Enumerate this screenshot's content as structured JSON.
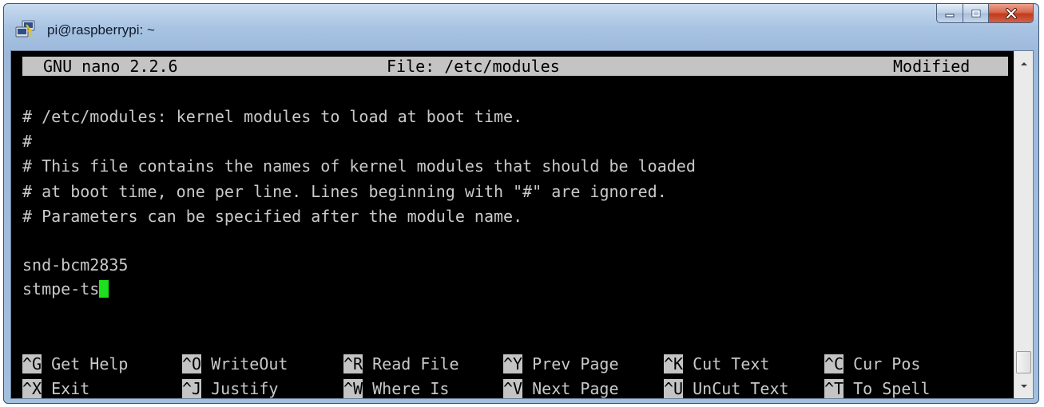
{
  "window": {
    "title": "pi@raspberrypi: ~",
    "icon": "putty-icon",
    "buttons": [
      "minimize-icon",
      "maximize-icon",
      "close-icon"
    ]
  },
  "nano": {
    "version": "GNU nano 2.2.6",
    "file": "File: /etc/modules",
    "status": "Modified",
    "lines": [
      "# /etc/modules: kernel modules to load at boot time.",
      "#",
      "# This file contains the names of kernel modules that should be loaded",
      "# at boot time, one per line. Lines beginning with \"#\" are ignored.",
      "# Parameters can be specified after the module name.",
      "",
      "snd-bcm2835",
      "stmpe-ts"
    ],
    "shortcuts_row1": [
      {
        "key": "^G",
        "label": " Get Help"
      },
      {
        "key": "^O",
        "label": " WriteOut"
      },
      {
        "key": "^R",
        "label": " Read File"
      },
      {
        "key": "^Y",
        "label": " Prev Page"
      },
      {
        "key": "^K",
        "label": " Cut Text"
      },
      {
        "key": "^C",
        "label": " Cur Pos"
      }
    ],
    "shortcuts_row2": [
      {
        "key": "^X",
        "label": " Exit"
      },
      {
        "key": "^J",
        "label": " Justify"
      },
      {
        "key": "^W",
        "label": " Where Is"
      },
      {
        "key": "^V",
        "label": " Next Page"
      },
      {
        "key": "^U",
        "label": " UnCut Text"
      },
      {
        "key": "^T",
        "label": " To Spell"
      }
    ]
  },
  "colors": {
    "terminal_bg": "#000000",
    "terminal_fg": "#c9c9c9",
    "header_bg": "#c4c4c4",
    "cursor": "#1de11d"
  }
}
